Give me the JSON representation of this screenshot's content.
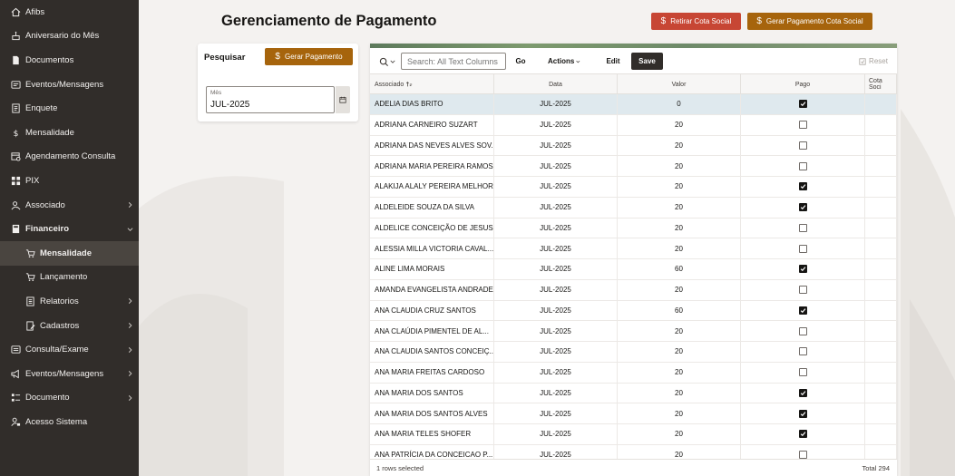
{
  "sidebar": {
    "items": [
      {
        "label": "Afibs",
        "icon": "home-icon",
        "sub": false,
        "active": false,
        "bold": false,
        "chevron": ""
      },
      {
        "label": "Aniversario do Mês",
        "icon": "cake-icon",
        "sub": false,
        "active": false,
        "bold": false,
        "chevron": ""
      },
      {
        "label": "Documentos",
        "icon": "document-icon",
        "sub": false,
        "active": false,
        "bold": false,
        "chevron": ""
      },
      {
        "label": "Eventos/Mensagens",
        "icon": "messages-icon",
        "sub": false,
        "active": false,
        "bold": false,
        "chevron": ""
      },
      {
        "label": "Enquete",
        "icon": "survey-icon",
        "sub": false,
        "active": false,
        "bold": false,
        "chevron": ""
      },
      {
        "label": "Mensalidade",
        "icon": "dollar-icon",
        "sub": false,
        "active": false,
        "bold": false,
        "chevron": ""
      },
      {
        "label": "Agendamento Consulta",
        "icon": "calendar-user-icon",
        "sub": false,
        "active": false,
        "bold": false,
        "chevron": ""
      },
      {
        "label": "PIX",
        "icon": "pix-icon",
        "sub": false,
        "active": false,
        "bold": false,
        "chevron": ""
      },
      {
        "label": "Associado",
        "icon": "user-key-icon",
        "sub": false,
        "active": false,
        "bold": false,
        "chevron": "right"
      },
      {
        "label": "Financeiro",
        "icon": "financial-icon",
        "sub": false,
        "active": false,
        "bold": true,
        "chevron": "down"
      },
      {
        "label": "Mensalidade",
        "icon": "cart-icon",
        "sub": true,
        "active": true,
        "bold": true,
        "chevron": ""
      },
      {
        "label": "Lançamento",
        "icon": "cart-icon",
        "sub": true,
        "active": false,
        "bold": false,
        "chevron": ""
      },
      {
        "label": "Relatorios",
        "icon": "report-icon",
        "sub": true,
        "active": false,
        "bold": false,
        "chevron": "right"
      },
      {
        "label": "Cadastros",
        "icon": "edit-doc-icon",
        "sub": true,
        "active": false,
        "bold": false,
        "chevron": "right"
      },
      {
        "label": "Consulta/Exame",
        "icon": "list-icon",
        "sub": false,
        "active": false,
        "bold": false,
        "chevron": "right"
      },
      {
        "label": "Eventos/Mensagens",
        "icon": "megaphone-icon",
        "sub": false,
        "active": false,
        "bold": false,
        "chevron": "right"
      },
      {
        "label": "Documento",
        "icon": "grid-list-icon",
        "sub": false,
        "active": false,
        "bold": false,
        "chevron": "right"
      },
      {
        "label": "Acesso Sistema",
        "icon": "user-lock-icon",
        "sub": false,
        "active": false,
        "bold": false,
        "chevron": ""
      }
    ]
  },
  "header": {
    "title": "Gerenciamento de Pagamento",
    "btn_retirar": "Retirar Cota Social",
    "btn_gerar_cota": "Gerar Pagamento Cota Social",
    "dollar": "$"
  },
  "search": {
    "title": "Pesquisar",
    "btn_gerar": "Gerar Pagamento",
    "mes_label": "Mês",
    "mes_value": "JUL-2025"
  },
  "toolbar": {
    "search_placeholder": "Search: All Text Columns",
    "go": "Go",
    "actions": "Actions",
    "edit": "Edit",
    "save": "Save",
    "reset": "Reset"
  },
  "grid": {
    "columns": [
      "Associado",
      "Data",
      "Valor",
      "Pago",
      "Cota Soci"
    ],
    "rows": [
      {
        "associado": "ADELIA DIAS BRITO",
        "data": "JUL-2025",
        "valor": "0",
        "pago": true,
        "selected": true
      },
      {
        "associado": "ADRIANA CARNEIRO SUZART",
        "data": "JUL-2025",
        "valor": "20",
        "pago": false,
        "selected": false
      },
      {
        "associado": "ADRIANA DAS NEVES ALVES SOV...",
        "data": "JUL-2025",
        "valor": "20",
        "pago": false,
        "selected": false
      },
      {
        "associado": "ADRIANA MARIA PEREIRA RAMOS",
        "data": "JUL-2025",
        "valor": "20",
        "pago": false,
        "selected": false
      },
      {
        "associado": "ALAKIJA ALALY PEREIRA MELHOR",
        "data": "JUL-2025",
        "valor": "20",
        "pago": true,
        "selected": false
      },
      {
        "associado": "ALDELEIDE SOUZA DA SILVA",
        "data": "JUL-2025",
        "valor": "20",
        "pago": true,
        "selected": false
      },
      {
        "associado": "ALDELICE CONCEIÇÃO DE JESUS ...",
        "data": "JUL-2025",
        "valor": "20",
        "pago": false,
        "selected": false
      },
      {
        "associado": "ALESSIA MILLA VICTORIA CAVAL...",
        "data": "JUL-2025",
        "valor": "20",
        "pago": false,
        "selected": false
      },
      {
        "associado": "ALINE LIMA MORAIS",
        "data": "JUL-2025",
        "valor": "60",
        "pago": true,
        "selected": false
      },
      {
        "associado": "AMANDA EVANGELISTA ANDRADE",
        "data": "JUL-2025",
        "valor": "20",
        "pago": false,
        "selected": false
      },
      {
        "associado": "ANA CLAUDIA CRUZ SANTOS",
        "data": "JUL-2025",
        "valor": "60",
        "pago": true,
        "selected": false
      },
      {
        "associado": "ANA CLAÚDIA PIMENTEL DE AL...",
        "data": "JUL-2025",
        "valor": "20",
        "pago": false,
        "selected": false
      },
      {
        "associado": "ANA CLAUDIA SANTOS CONCEIÇ...",
        "data": "JUL-2025",
        "valor": "20",
        "pago": false,
        "selected": false
      },
      {
        "associado": "ANA MARIA FREITAS CARDOSO",
        "data": "JUL-2025",
        "valor": "20",
        "pago": false,
        "selected": false
      },
      {
        "associado": "ANA MARIA DOS SANTOS",
        "data": "JUL-2025",
        "valor": "20",
        "pago": true,
        "selected": false
      },
      {
        "associado": "ANA MARIA DOS SANTOS ALVES",
        "data": "JUL-2025",
        "valor": "20",
        "pago": true,
        "selected": false
      },
      {
        "associado": "ANA MARIA TELES SHOFER",
        "data": "JUL-2025",
        "valor": "20",
        "pago": true,
        "selected": false
      },
      {
        "associado": "ANA PATRÍCIA DA CONCEICAO P...",
        "data": "JUL-2025",
        "valor": "20",
        "pago": false,
        "selected": false
      }
    ],
    "footer_selected": "1 rows selected",
    "footer_total": "Total 294"
  },
  "colors": {
    "sidebar_bg": "#312d2a",
    "red_button": "#c74634",
    "gold_button": "#a6640c",
    "save_button": "#312d2a",
    "selected_row": "#dfe9ee"
  }
}
